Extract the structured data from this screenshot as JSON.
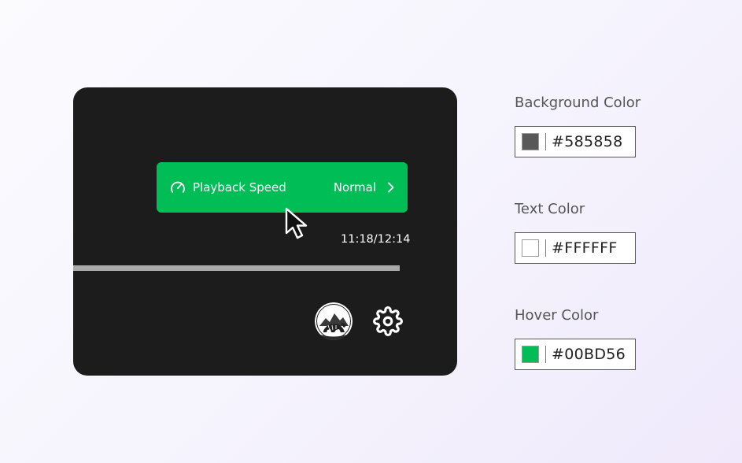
{
  "player": {
    "background_color": "#1c1c1c",
    "speed_menu": {
      "label": "Playback Speed",
      "value": "Normal",
      "icon": "gauge-icon",
      "chevron": "chevron-right-icon",
      "hover_color": "#00BD56"
    },
    "time": "11:18/12:14",
    "progress": 0.85,
    "avatar_icon": "tiger-avatar-icon",
    "settings_icon": "gear-icon",
    "cursor_icon": "mouse-pointer-icon"
  },
  "settings": [
    {
      "label": "Background Color",
      "value": "#585858",
      "swatch": "#585858"
    },
    {
      "label": "Text Color",
      "value": "#FFFFFF",
      "swatch": "#FFFFFF"
    },
    {
      "label": "Hover Color",
      "value": "#00BD56",
      "swatch": "#00BD56"
    }
  ]
}
